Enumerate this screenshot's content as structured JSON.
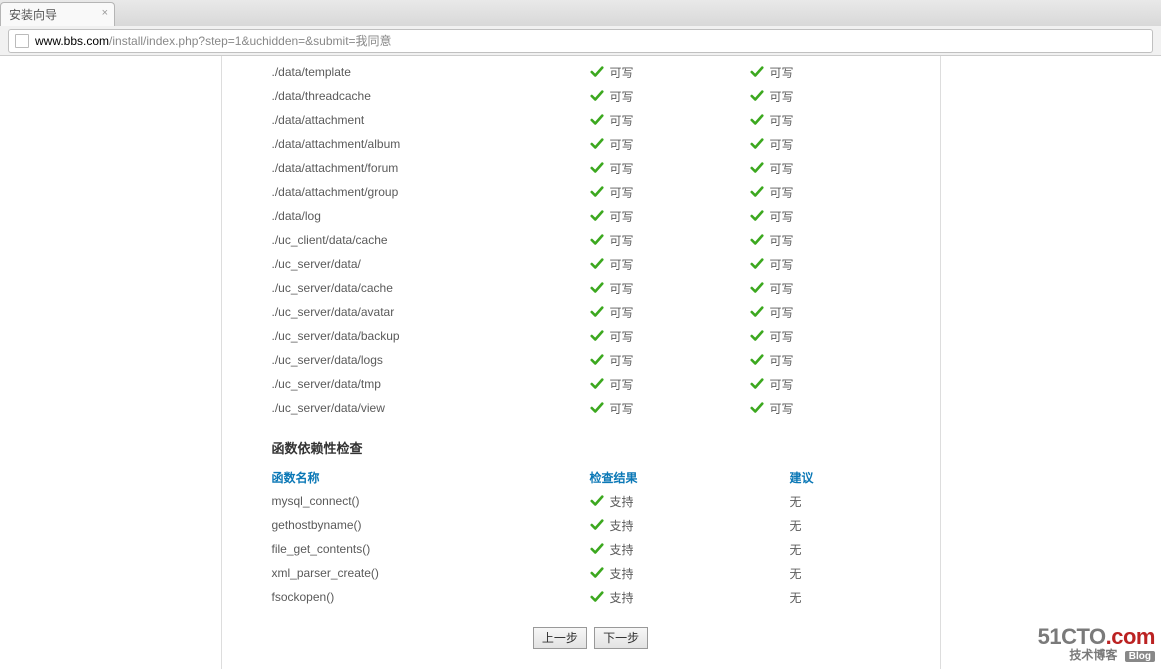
{
  "browser": {
    "tab_title": "安装向导",
    "url_host": "www.bbs.com",
    "url_path": "/install/index.php?step=1&uchidden=&submit=我同意"
  },
  "dir_check": {
    "status_label": "可写",
    "rows": [
      "./data/template",
      "./data/threadcache",
      "./data/attachment",
      "./data/attachment/album",
      "./data/attachment/forum",
      "./data/attachment/group",
      "./data/log",
      "./uc_client/data/cache",
      "./uc_server/data/",
      "./uc_server/data/cache",
      "./uc_server/data/avatar",
      "./uc_server/data/backup",
      "./uc_server/data/logs",
      "./uc_server/data/tmp",
      "./uc_server/data/view"
    ]
  },
  "func_section": {
    "title": "函数依赖性检查",
    "headers": {
      "name": "函数名称",
      "result": "检查结果",
      "suggest": "建议"
    },
    "result_label": "支持",
    "suggest_label": "无",
    "funcs": [
      "mysql_connect()",
      "gethostbyname()",
      "file_get_contents()",
      "xml_parser_create()",
      "fsockopen()"
    ]
  },
  "buttons": {
    "prev": "上一步",
    "next": "下一步"
  },
  "watermark": {
    "line1a": "51CTO",
    "line1b": ".com",
    "line2a": "技术博客",
    "line2b": "Blog"
  }
}
